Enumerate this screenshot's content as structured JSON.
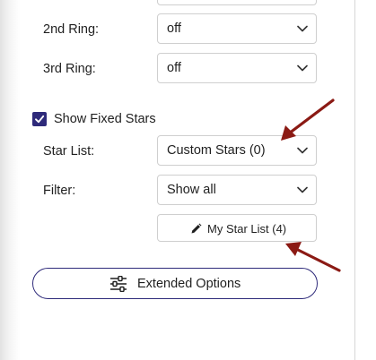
{
  "settings": {
    "ring2": {
      "label": "2nd Ring:",
      "value": "off"
    },
    "ring3": {
      "label": "3rd Ring:",
      "value": "off"
    },
    "fixed_stars": {
      "label": "Show Fixed Stars",
      "checked": true
    },
    "star_list": {
      "label": "Star List:",
      "value": "Custom Stars (0)"
    },
    "filter": {
      "label": "Filter:",
      "value": "Show all"
    },
    "my_star_list_button": {
      "label": "My Star List (4)",
      "icon": "pencil-icon"
    },
    "extended_options_button": {
      "label": "Extended Options",
      "icon": "sliders-icon"
    }
  },
  "colors": {
    "accent": "#2e2a7a",
    "annotation_arrow": "#8b1a14",
    "border": "#cfcfcf"
  }
}
